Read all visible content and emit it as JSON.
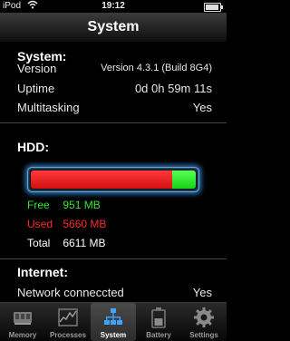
{
  "status": {
    "carrier": "iPod",
    "time": "19:12"
  },
  "nav": {
    "title": "System"
  },
  "system": {
    "title": "System:",
    "rows": [
      {
        "label": "Version",
        "value": "Version 4.3.1 (Build 8G4)"
      },
      {
        "label": "Uptime",
        "value": "0d 0h 59m 11s"
      },
      {
        "label": "Multitasking",
        "value": "Yes"
      }
    ]
  },
  "hdd": {
    "title": "HDD:",
    "used_fraction": 0.856,
    "free": {
      "label": "Free",
      "value": "951 MB"
    },
    "used": {
      "label": "Used",
      "value": "5660 MB"
    },
    "total": {
      "label": "Total",
      "value": "6611 MB"
    },
    "colors": {
      "used": "#ff2a2a",
      "free": "#35e235",
      "glow": "#2d78b8"
    }
  },
  "internet": {
    "title": "Internet:",
    "rows": [
      {
        "label": "Network conneccted",
        "value": "Yes"
      }
    ]
  },
  "tabs": [
    {
      "label": "Memory",
      "icon": "memory-chip-icon"
    },
    {
      "label": "Processes",
      "icon": "graph-icon"
    },
    {
      "label": "System",
      "icon": "system-tree-icon"
    },
    {
      "label": "Battery",
      "icon": "battery-icon"
    },
    {
      "label": "Settings",
      "icon": "gear-icon"
    }
  ],
  "active_tab": "System"
}
